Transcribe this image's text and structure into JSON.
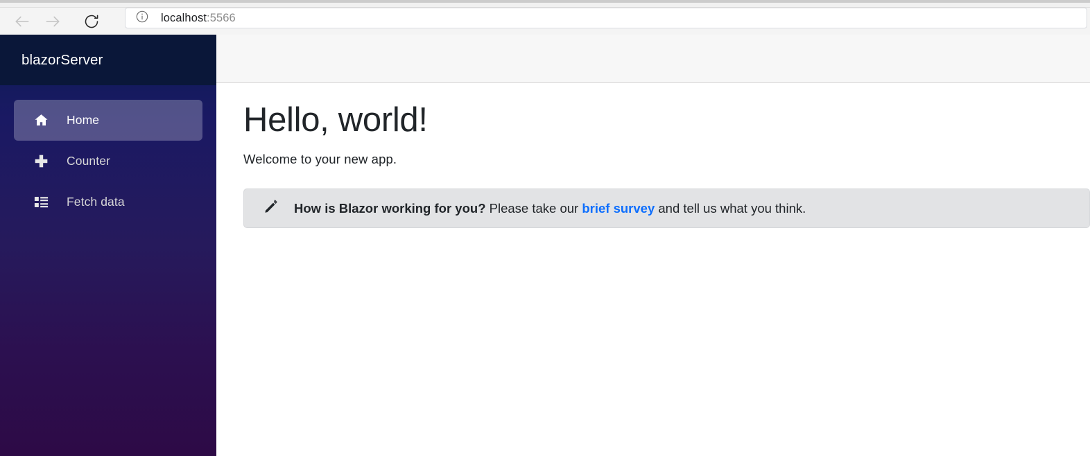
{
  "browser": {
    "back_icon": "arrow-left-icon",
    "forward_icon": "arrow-right-icon",
    "reload_icon": "reload-icon",
    "info_icon": "info-circle-icon",
    "url_host": "localhost",
    "url_port": ":5566",
    "url_full": "localhost:5566"
  },
  "sidebar": {
    "brand": "blazorServer",
    "items": [
      {
        "label": "Home",
        "icon": "home-icon",
        "active": true
      },
      {
        "label": "Counter",
        "icon": "plus-icon",
        "active": false
      },
      {
        "label": "Fetch data",
        "icon": "list-rich-icon",
        "active": false
      }
    ]
  },
  "main": {
    "title": "Hello, world!",
    "subtitle": "Welcome to your new app.",
    "alert": {
      "icon": "pencil-icon",
      "bold_text": "How is Blazor working for you?",
      "text_before_link": " Please take our ",
      "link_text": "brief survey",
      "text_after_link": " and tell us what you think."
    }
  },
  "colors": {
    "navbar_header": "#0a1739",
    "sidebar_gradient_top": "#0c1c56",
    "sidebar_gradient_bottom": "#2d0a46",
    "active_item_bg": "rgba(255,255,255,0.25)",
    "alert_bg": "#e2e3e5",
    "link": "#0d6efd",
    "top_row_bg": "#f7f7f7",
    "text": "#212529"
  }
}
